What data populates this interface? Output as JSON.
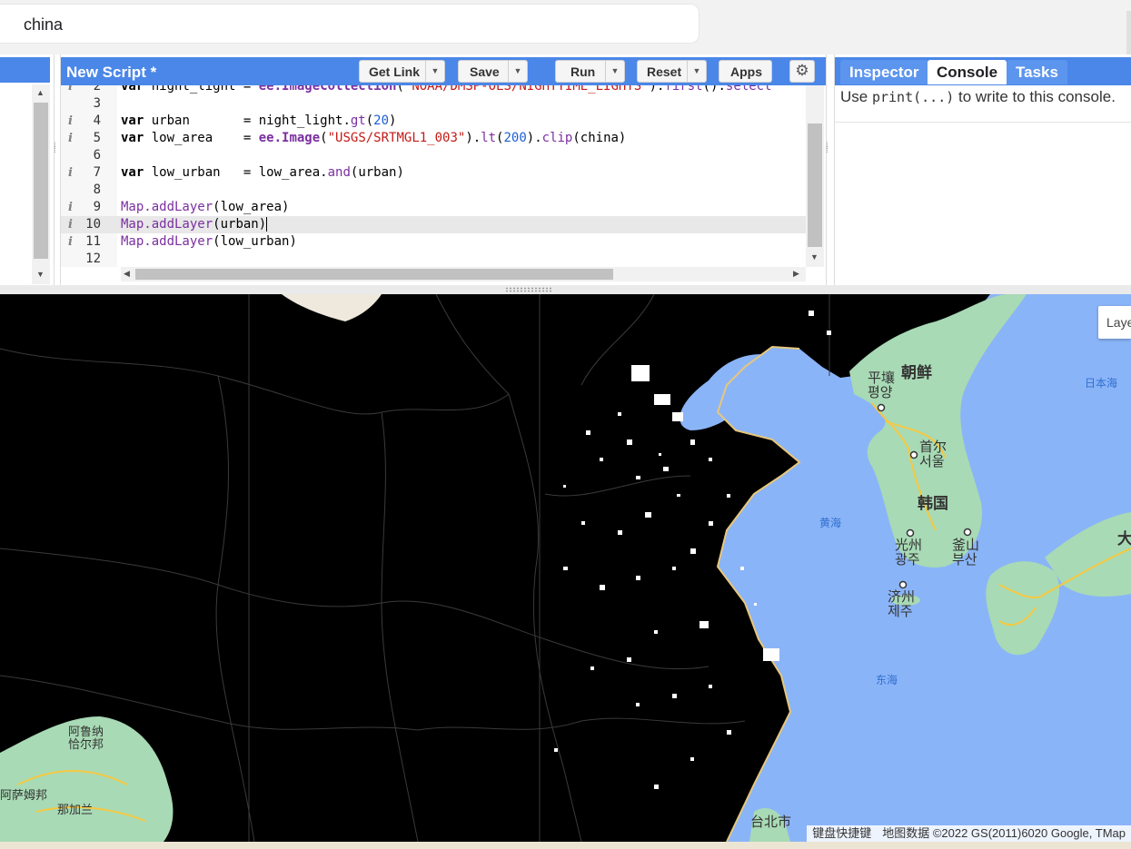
{
  "search": {
    "value": "china"
  },
  "editor": {
    "title": "New Script *",
    "buttons": {
      "get_link": "Get Link",
      "save": "Save",
      "run": "Run",
      "reset": "Reset",
      "apps": "Apps"
    },
    "lines": [
      {
        "n": "2",
        "info": true,
        "text": "var night_light = ee.ImageCollection('NOAA/DMSP-OLS/NIGHTTIME_LIGHTS').first().select"
      },
      {
        "n": "3",
        "info": false,
        "text": ""
      },
      {
        "n": "4",
        "info": true,
        "text": "var urban       = night_light.gt(20)"
      },
      {
        "n": "5",
        "info": true,
        "text": "var low_area    = ee.Image(\"USGS/SRTMGL1_003\").lt(200).clip(china)"
      },
      {
        "n": "6",
        "info": false,
        "text": ""
      },
      {
        "n": "7",
        "info": true,
        "text": "var low_urban   = low_area.and(urban)"
      },
      {
        "n": "8",
        "info": false,
        "text": ""
      },
      {
        "n": "9",
        "info": true,
        "text": "Map.addLayer(low_area)"
      },
      {
        "n": "10",
        "info": true,
        "text": "Map.addLayer(urban)"
      },
      {
        "n": "11",
        "info": true,
        "text": "Map.addLayer(low_urban)"
      },
      {
        "n": "12",
        "info": false,
        "text": ""
      }
    ],
    "active_line": "10"
  },
  "right_panel": {
    "tabs": [
      "Inspector",
      "Console",
      "Tasks"
    ],
    "active_tab": "Console",
    "console_pre": "Use ",
    "console_code": "print(...)",
    "console_post": " to write to this console."
  },
  "map": {
    "layers_label": "Layers",
    "labels": {
      "korea_north": "朝鲜",
      "pyongyang_zh": "平壤",
      "pyongyang_ko": "평양",
      "seoul_zh": "首尔",
      "seoul_ko": "서울",
      "korea_south": "韩国",
      "yellow_sea": "黄海",
      "sea_of_japan": "日本海",
      "gwangju_zh": "光州",
      "gwangju_ko": "광주",
      "busan_zh": "釜山",
      "busan_ko": "부산",
      "jeju_zh": "济州",
      "jeju_ko": "제주",
      "east_sea": "东海",
      "japan_fragment": "大",
      "taipei": "台北市",
      "nepal_area_1": "阿鲁纳",
      "nepal_area_2": "恰尔邦",
      "assam": "阿萨姆邦",
      "bengal": "那加兰"
    },
    "attribution": {
      "shortcuts": "键盘快捷键",
      "data": "地图数据 ©2022 GS(2011)6020 Google, TMap"
    }
  },
  "colors": {
    "accent": "#4a87e8",
    "sea": "#8ab4f8",
    "land": "#a8dab5",
    "night_mask": "#000000",
    "urban": "#ffffff"
  }
}
